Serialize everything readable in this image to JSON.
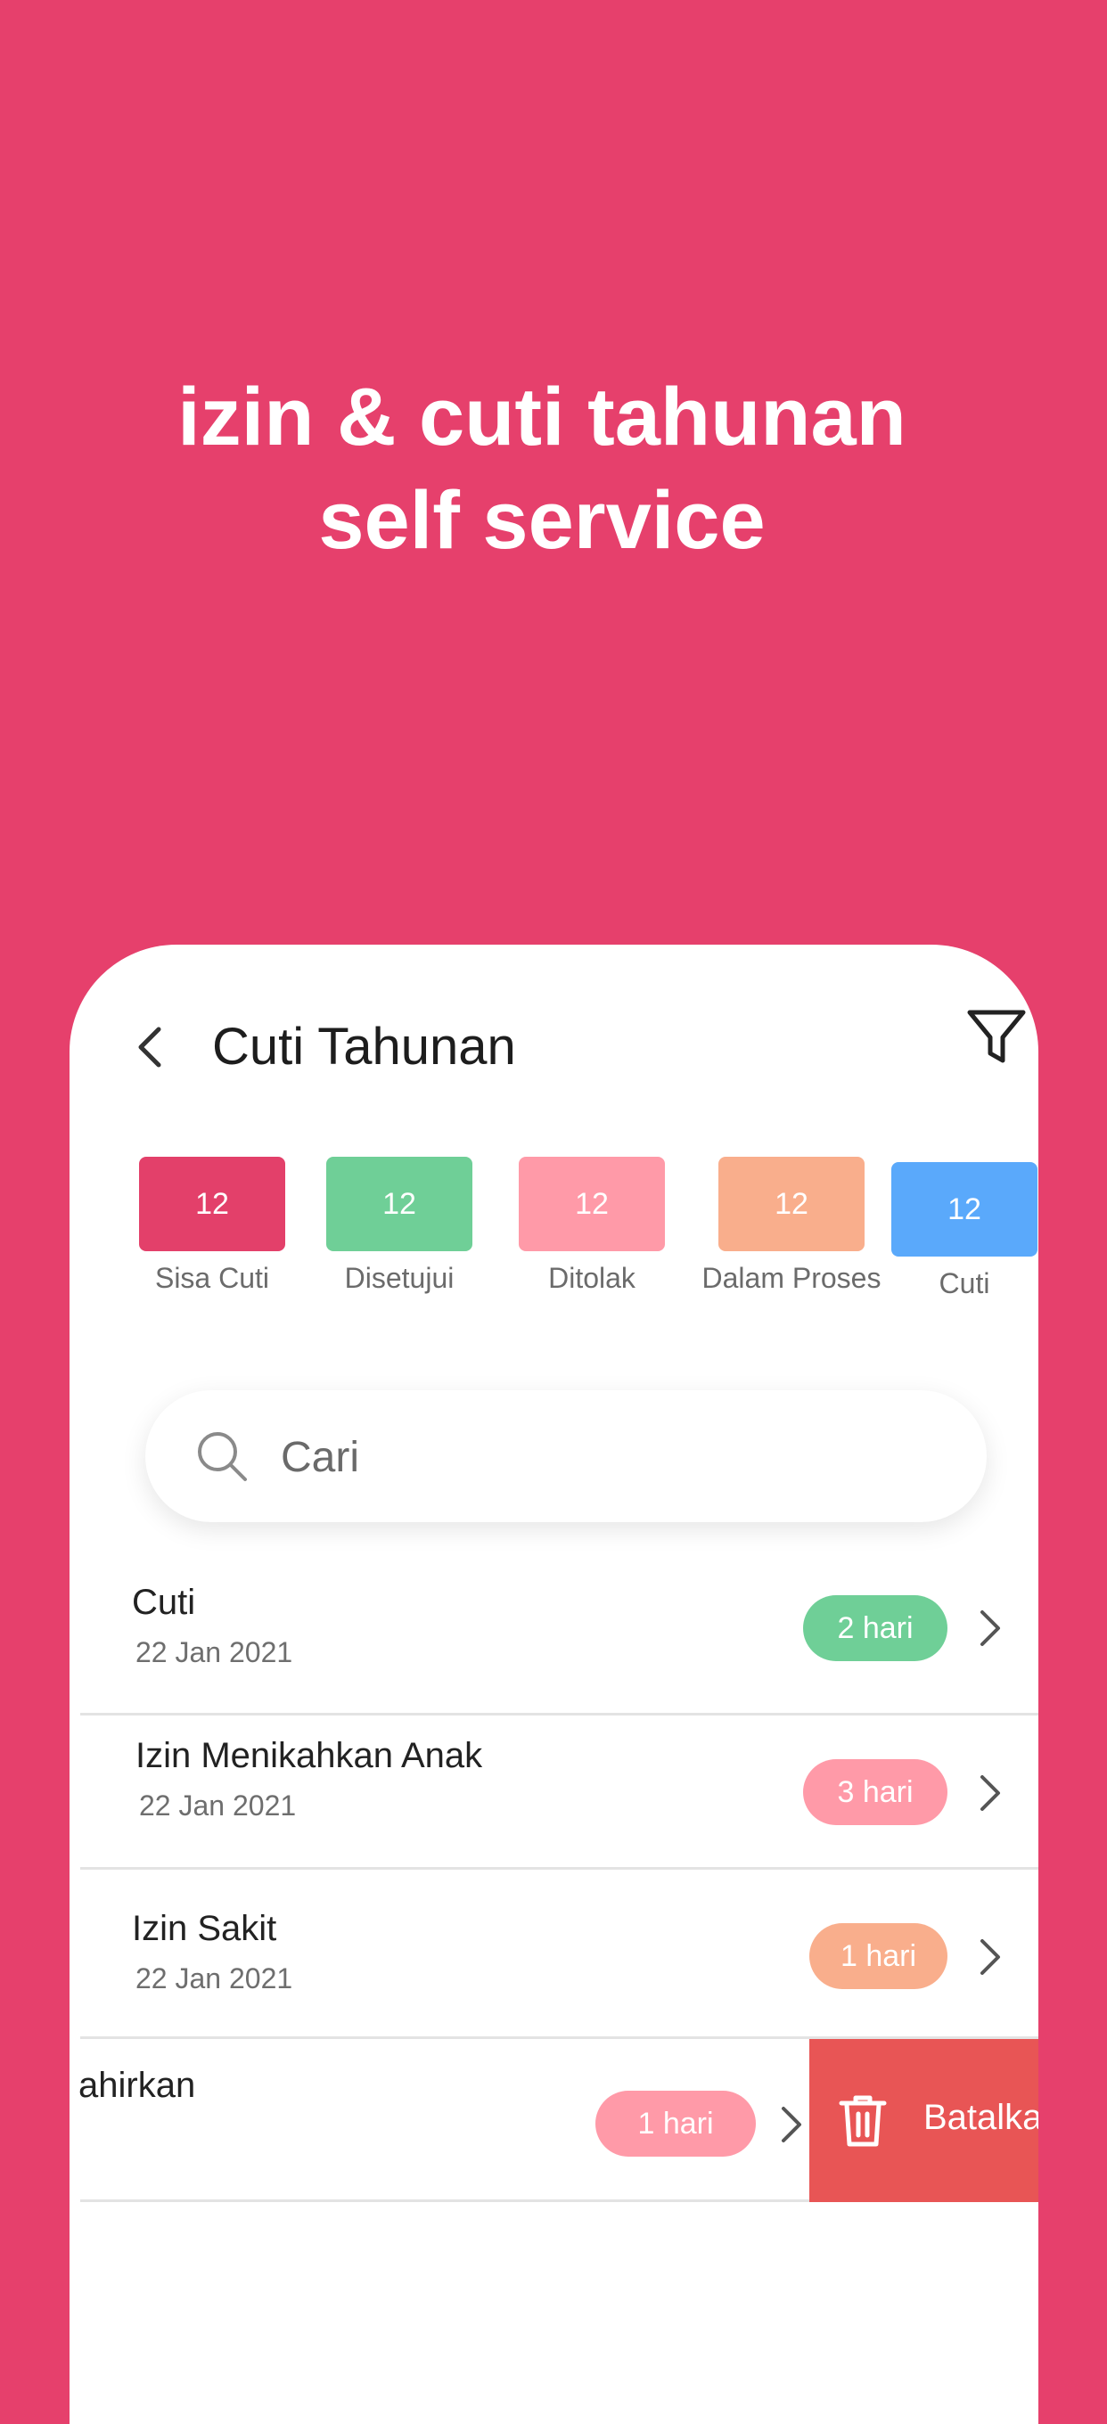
{
  "headline": {
    "line1": "izin & cuti tahunan",
    "line2": "self service"
  },
  "header": {
    "title": "Cuti Tahunan",
    "back_icon": "chevron-left-icon",
    "filter_icon": "filter-icon"
  },
  "stats": [
    {
      "value": "12",
      "label": "Sisa Cuti",
      "color": "#e3406a"
    },
    {
      "value": "12",
      "label": "Disetujui",
      "color": "#6fcf97"
    },
    {
      "value": "12",
      "label": "Ditolak",
      "color": "#ff9aa8"
    },
    {
      "value": "12",
      "label": "Dalam Proses",
      "color": "#f9ae8c"
    },
    {
      "value": "12",
      "label": "Cuti",
      "color": "#5aa9fb"
    }
  ],
  "search": {
    "placeholder": "Cari",
    "icon": "search-icon"
  },
  "list": [
    {
      "title": "Cuti",
      "date": "22 Jan 2021",
      "duration": "2 hari",
      "color": "#6fcf97"
    },
    {
      "title": "Izin Menikahkan Anak",
      "date": "22 Jan 2021",
      "duration": "3 hari",
      "color": "#ff9aa8"
    },
    {
      "title": "Izin Sakit",
      "date": "22 Jan 2021",
      "duration": "1 hari",
      "color": "#f9ae8c"
    },
    {
      "title": "ahirkan",
      "date": "",
      "duration": "1 hari",
      "color": "#ff9aa8"
    }
  ],
  "swipe_action": {
    "label": "Batalka",
    "icon": "trash-icon",
    "color": "#e85555"
  }
}
